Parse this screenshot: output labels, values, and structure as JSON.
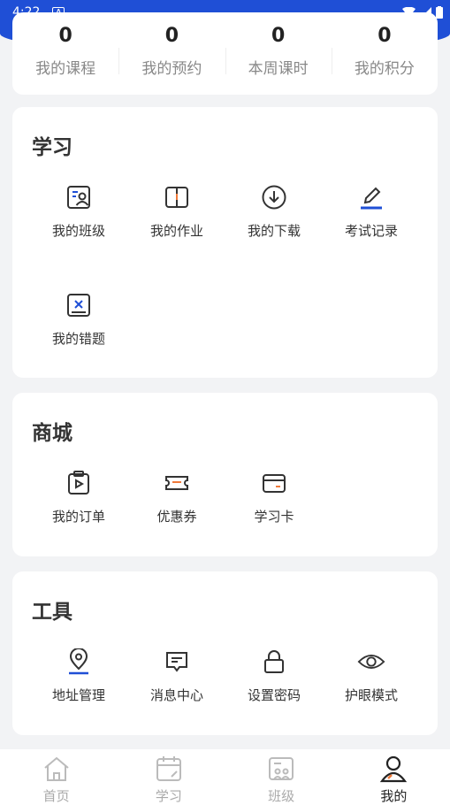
{
  "status_bar": {
    "time": "4:22",
    "notification_icon": "A"
  },
  "stats": [
    {
      "value": "0",
      "label": "我的课程"
    },
    {
      "value": "0",
      "label": "我的预约"
    },
    {
      "value": "0",
      "label": "本周课时"
    },
    {
      "value": "0",
      "label": "我的积分"
    }
  ],
  "study": {
    "title": "学习",
    "items": [
      {
        "label": "我的班级",
        "icon": "class-icon"
      },
      {
        "label": "我的作业",
        "icon": "book-icon"
      },
      {
        "label": "我的下载",
        "icon": "download-icon"
      },
      {
        "label": "考试记录",
        "icon": "pencil-icon"
      },
      {
        "label": "我的错题",
        "icon": "wrong-question-icon"
      }
    ]
  },
  "shop": {
    "title": "商城",
    "items": [
      {
        "label": "我的订单",
        "icon": "order-icon"
      },
      {
        "label": "优惠券",
        "icon": "coupon-icon"
      },
      {
        "label": "学习卡",
        "icon": "card-icon"
      }
    ]
  },
  "tools": {
    "title": "工具",
    "items": [
      {
        "label": "地址管理",
        "icon": "location-icon"
      },
      {
        "label": "消息中心",
        "icon": "message-icon"
      },
      {
        "label": "设置密码",
        "icon": "lock-icon"
      },
      {
        "label": "护眼模式",
        "icon": "eye-icon"
      }
    ]
  },
  "tabbar": {
    "tabs": [
      {
        "label": "首页",
        "icon": "home-icon"
      },
      {
        "label": "学习",
        "icon": "calendar-icon"
      },
      {
        "label": "班级",
        "icon": "class-group-icon"
      },
      {
        "label": "我的",
        "icon": "profile-icon"
      }
    ],
    "active_index": 3
  },
  "colors": {
    "accent": "#1f4fd6",
    "orange": "#f07a3a"
  }
}
